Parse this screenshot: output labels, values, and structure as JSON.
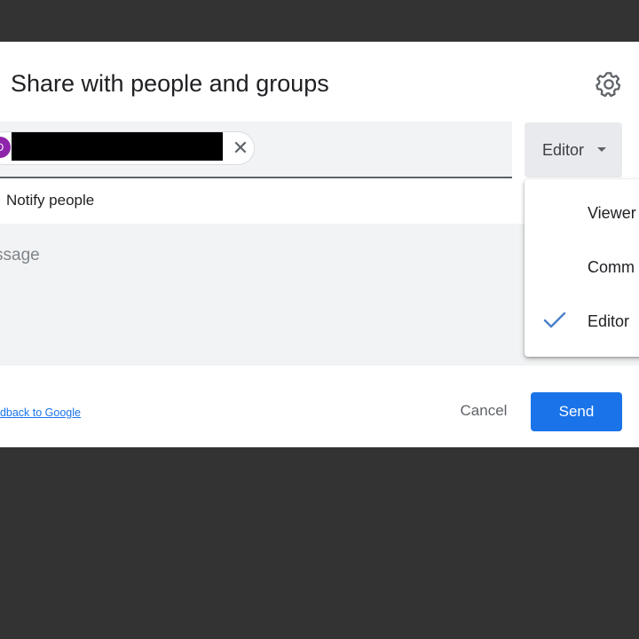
{
  "dialog": {
    "title": "Share with people and groups",
    "gear_icon": "gear-icon"
  },
  "recipient": {
    "avatar_letter": "D",
    "avatar_color": "#8e24aa",
    "close_symbol": "✕"
  },
  "role": {
    "selected_label": "Editor"
  },
  "notify": {
    "label": "Notify people"
  },
  "message": {
    "placeholder": "ssage"
  },
  "footer": {
    "feedback_link": "edback to Google",
    "cancel_label": "Cancel",
    "send_label": "Send"
  },
  "role_menu": {
    "items": [
      {
        "label": "Viewer"
      },
      {
        "label": "Comm"
      },
      {
        "label": "Editor",
        "checked": true
      }
    ]
  },
  "colors": {
    "accent": "#1a73e8",
    "backdrop": "#333333"
  }
}
